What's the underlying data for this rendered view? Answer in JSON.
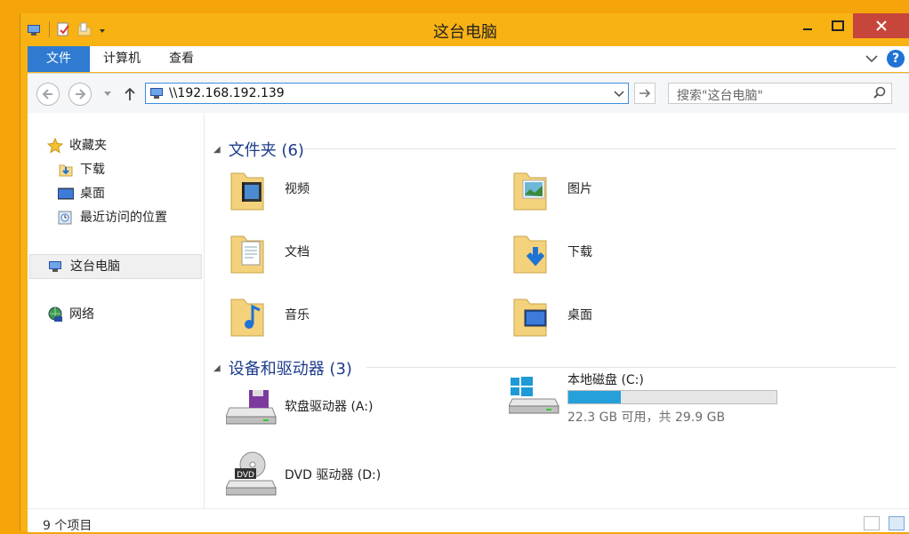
{
  "window": {
    "title": "这台电脑"
  },
  "ribbon": {
    "tabs": [
      "文件",
      "计算机",
      "查看"
    ]
  },
  "address": {
    "path": "\\\\192.168.192.139"
  },
  "search": {
    "placeholder": "搜索\"这台电脑\""
  },
  "sidebar": {
    "favorites": {
      "label": "收藏夹",
      "items": [
        "下载",
        "桌面",
        "最近访问的位置"
      ]
    },
    "this_pc": "这台电脑",
    "network": "网络"
  },
  "folders_group": {
    "title": "文件夹 (6)",
    "items": [
      "视频",
      "图片",
      "文档",
      "下载",
      "音乐",
      "桌面"
    ]
  },
  "devices_group": {
    "title": "设备和驱动器 (3)",
    "floppy": "软盘驱动器 (A:)",
    "local_disk": {
      "name": "本地磁盘 (C:)",
      "space": "22.3 GB 可用，共 29.9 GB",
      "used_fraction": 0.254
    },
    "dvd": "DVD 驱动器 (D:)",
    "dvd_badge": "DVD"
  },
  "status": {
    "count": "9 个项目"
  },
  "colors": {
    "accent": "#2e7bd1",
    "frame": "#f9b214",
    "close": "#c7463b",
    "group_title": "#1e3c8c"
  }
}
